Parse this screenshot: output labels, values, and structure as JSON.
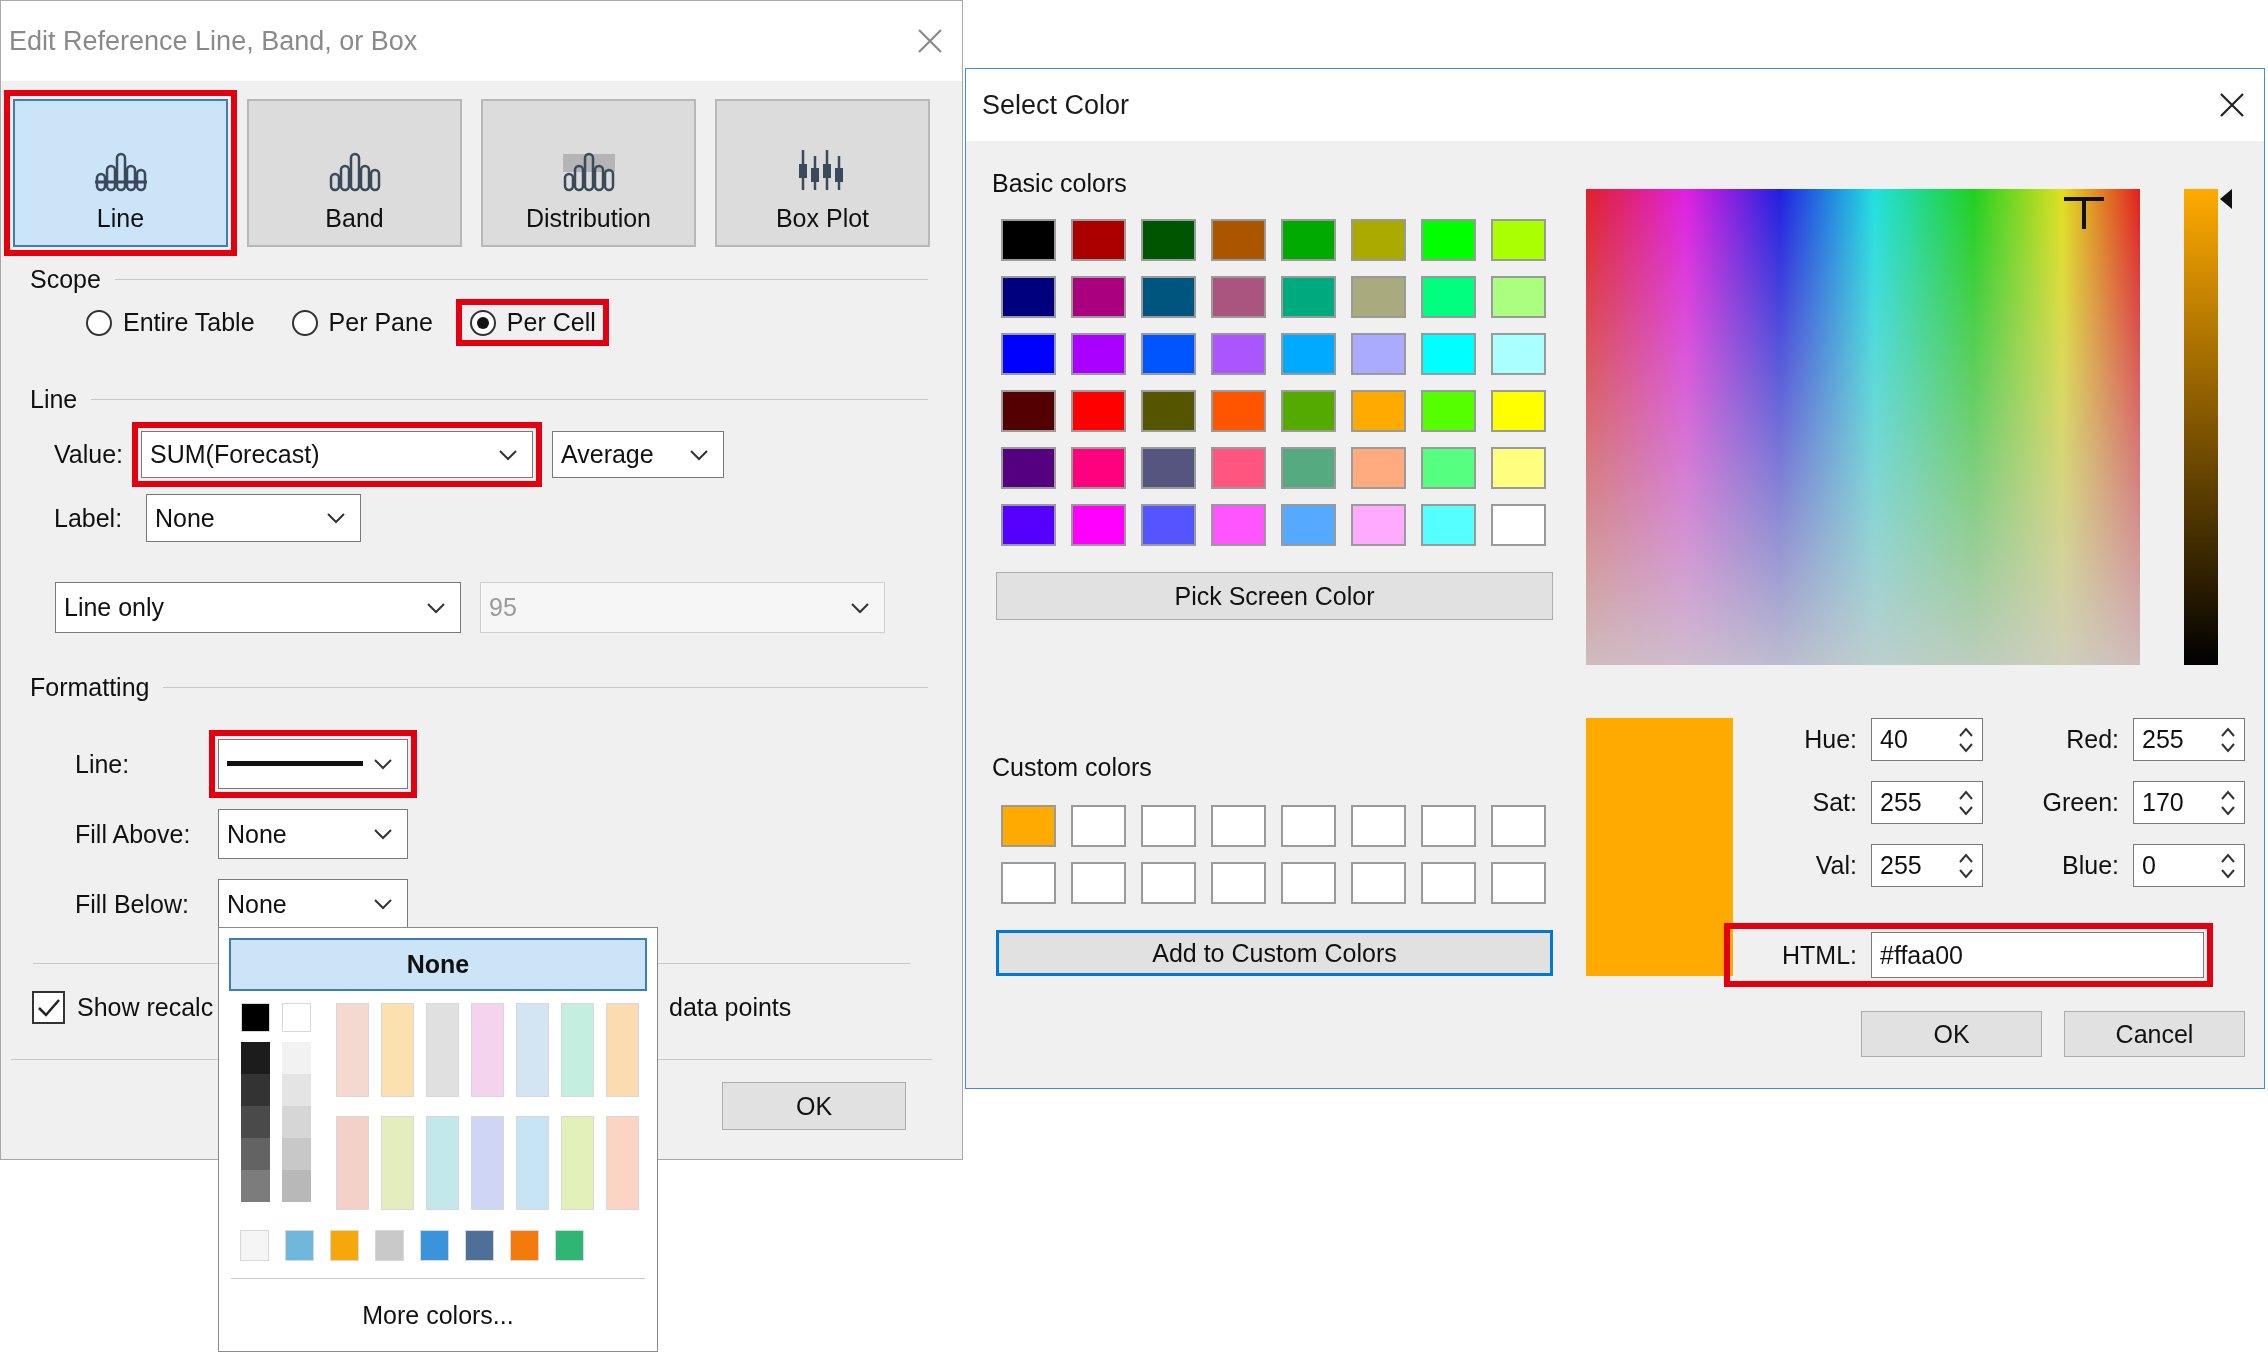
{
  "edit_dialog": {
    "title": "Edit Reference Line, Band, or Box",
    "tabs": [
      {
        "label": "Line",
        "kind": "line",
        "selected": true,
        "highlighted": true
      },
      {
        "label": "Band",
        "kind": "band",
        "selected": false,
        "highlighted": false
      },
      {
        "label": "Distribution",
        "kind": "distribution",
        "selected": false,
        "highlighted": false
      },
      {
        "label": "Box Plot",
        "kind": "boxplot",
        "selected": false,
        "highlighted": false
      }
    ],
    "scope": {
      "heading": "Scope",
      "options": [
        {
          "label": "Entire Table",
          "selected": false,
          "highlighted": false
        },
        {
          "label": "Per Pane",
          "selected": false,
          "highlighted": false
        },
        {
          "label": "Per Cell",
          "selected": true,
          "highlighted": true
        }
      ]
    },
    "line": {
      "heading": "Line",
      "value_label": "Value:",
      "value": "SUM(Forecast)",
      "value_highlighted": true,
      "aggregation": "Average",
      "label_label": "Label:",
      "label_value": "None",
      "mode": "Line only",
      "confidence": "95",
      "confidence_disabled": true
    },
    "formatting": {
      "heading": "Formatting",
      "rows": [
        {
          "label": "Line:",
          "kind": "line_style",
          "highlighted": true
        },
        {
          "label": "Fill Above:",
          "kind": "text",
          "value": "None",
          "highlighted": false
        },
        {
          "label": "Fill Below:",
          "kind": "text",
          "value": "None",
          "highlighted": false
        }
      ]
    },
    "show_recalc": {
      "checked": true,
      "label_start": "Show recalc",
      "label_end": "data points"
    },
    "ok_button": "OK"
  },
  "fill_popup": {
    "none_option": {
      "label": "None",
      "selected": true
    },
    "gray_columns": [
      {
        "top": {
          "color": "#000000"
        },
        "shades": [
          {
            "color": "#1c1c1c"
          },
          {
            "color": "#333333"
          },
          {
            "color": "#4a4a4a"
          },
          {
            "color": "#636363"
          },
          {
            "color": "#7c7c7c"
          }
        ]
      },
      {
        "top": {
          "color": "#ffffff"
        },
        "shades": [
          {
            "color": "#f2f2f2"
          },
          {
            "color": "#e4e4e4"
          },
          {
            "color": "#d6d6d6"
          },
          {
            "color": "#c8c8c8"
          },
          {
            "color": "#b8b8b8"
          }
        ]
      }
    ],
    "tints": [
      {
        "color": "#f3d9cf"
      },
      {
        "color": "#fbe0b0"
      },
      {
        "color": "#e0e0e0"
      },
      {
        "color": "#f3d3ee"
      },
      {
        "color": "#d3e4f2"
      },
      {
        "color": "#c4eee0"
      },
      {
        "color": "#fbdcb0"
      },
      {
        "color": "#f4d1c8"
      },
      {
        "color": "#e3edbe"
      },
      {
        "color": "#c3e8ec"
      },
      {
        "color": "#cfd6f5"
      },
      {
        "color": "#c6e4f3"
      },
      {
        "color": "#e3f0b8"
      },
      {
        "color": "#fbd4c4"
      }
    ],
    "bottom_colors": [
      {
        "color": "#f5f5f5"
      },
      {
        "color": "#6fb7dd"
      },
      {
        "color": "#f5a70c"
      },
      {
        "color": "#c9c9c9"
      },
      {
        "color": "#3a94dc"
      },
      {
        "color": "#4e6f98"
      },
      {
        "color": "#f57a0d"
      },
      {
        "color": "#2fb574"
      }
    ],
    "more_label": "More colors..."
  },
  "color_dialog": {
    "title": "Select Color",
    "basic_label": "Basic colors",
    "basic_colors": [
      {
        "color": "#000000"
      },
      {
        "color": "#aa0000"
      },
      {
        "color": "#005500"
      },
      {
        "color": "#aa5500"
      },
      {
        "color": "#00aa00"
      },
      {
        "color": "#aaaa00"
      },
      {
        "color": "#00ff00"
      },
      {
        "color": "#aaff00"
      },
      {
        "color": "#00007f"
      },
      {
        "color": "#aa007f"
      },
      {
        "color": "#00557f"
      },
      {
        "color": "#aa557f"
      },
      {
        "color": "#00aa7f"
      },
      {
        "color": "#aaaa7f"
      },
      {
        "color": "#00ff7f"
      },
      {
        "color": "#aaff7f"
      },
      {
        "color": "#0000ff"
      },
      {
        "color": "#aa00ff"
      },
      {
        "color": "#0055ff"
      },
      {
        "color": "#aa55ff"
      },
      {
        "color": "#00aaff"
      },
      {
        "color": "#aaaaff"
      },
      {
        "color": "#00ffff"
      },
      {
        "color": "#aaffff"
      },
      {
        "color": "#550000"
      },
      {
        "color": "#ff0000"
      },
      {
        "color": "#555500"
      },
      {
        "color": "#ff5500"
      },
      {
        "color": "#55aa00"
      },
      {
        "color": "#ffaa00"
      },
      {
        "color": "#55ff00"
      },
      {
        "color": "#ffff00"
      },
      {
        "color": "#55007f"
      },
      {
        "color": "#ff007f"
      },
      {
        "color": "#55557f"
      },
      {
        "color": "#ff557f"
      },
      {
        "color": "#55aa7f"
      },
      {
        "color": "#ffaa7f"
      },
      {
        "color": "#55ff7f"
      },
      {
        "color": "#ffff7f"
      },
      {
        "color": "#5500ff"
      },
      {
        "color": "#ff00ff"
      },
      {
        "color": "#5555ff"
      },
      {
        "color": "#ff55ff"
      },
      {
        "color": "#55aaff"
      },
      {
        "color": "#ffaaff"
      },
      {
        "color": "#55ffff"
      },
      {
        "color": "#ffffff"
      }
    ],
    "pick_button": "Pick Screen Color",
    "custom_label": "Custom colors",
    "custom_colors": [
      {
        "color": "#ffaa00"
      },
      {
        "color": "#ffffff"
      },
      {
        "color": "#ffffff"
      },
      {
        "color": "#ffffff"
      },
      {
        "color": "#ffffff"
      },
      {
        "color": "#ffffff"
      },
      {
        "color": "#ffffff"
      },
      {
        "color": "#ffffff"
      },
      {
        "color": "#ffffff"
      },
      {
        "color": "#ffffff"
      },
      {
        "color": "#ffffff"
      },
      {
        "color": "#ffffff"
      },
      {
        "color": "#ffffff"
      },
      {
        "color": "#ffffff"
      },
      {
        "color": "#ffffff"
      },
      {
        "color": "#ffffff"
      }
    ],
    "add_button": "Add to Custom Colors",
    "add_focused": true,
    "value_slider": {
      "level": 1
    },
    "fields": [
      {
        "label": "Hue:",
        "value": "40"
      },
      {
        "label": "Red:",
        "value": "255"
      },
      {
        "label": "Sat:",
        "value": "255"
      },
      {
        "label": "Green:",
        "value": "170"
      },
      {
        "label": "Val:",
        "value": "255"
      },
      {
        "label": "Blue:",
        "value": "0"
      }
    ],
    "html": {
      "label": "HTML:",
      "value": "#ffaa00",
      "highlighted": true
    },
    "ok_button": "OK",
    "cancel_button": "Cancel"
  }
}
